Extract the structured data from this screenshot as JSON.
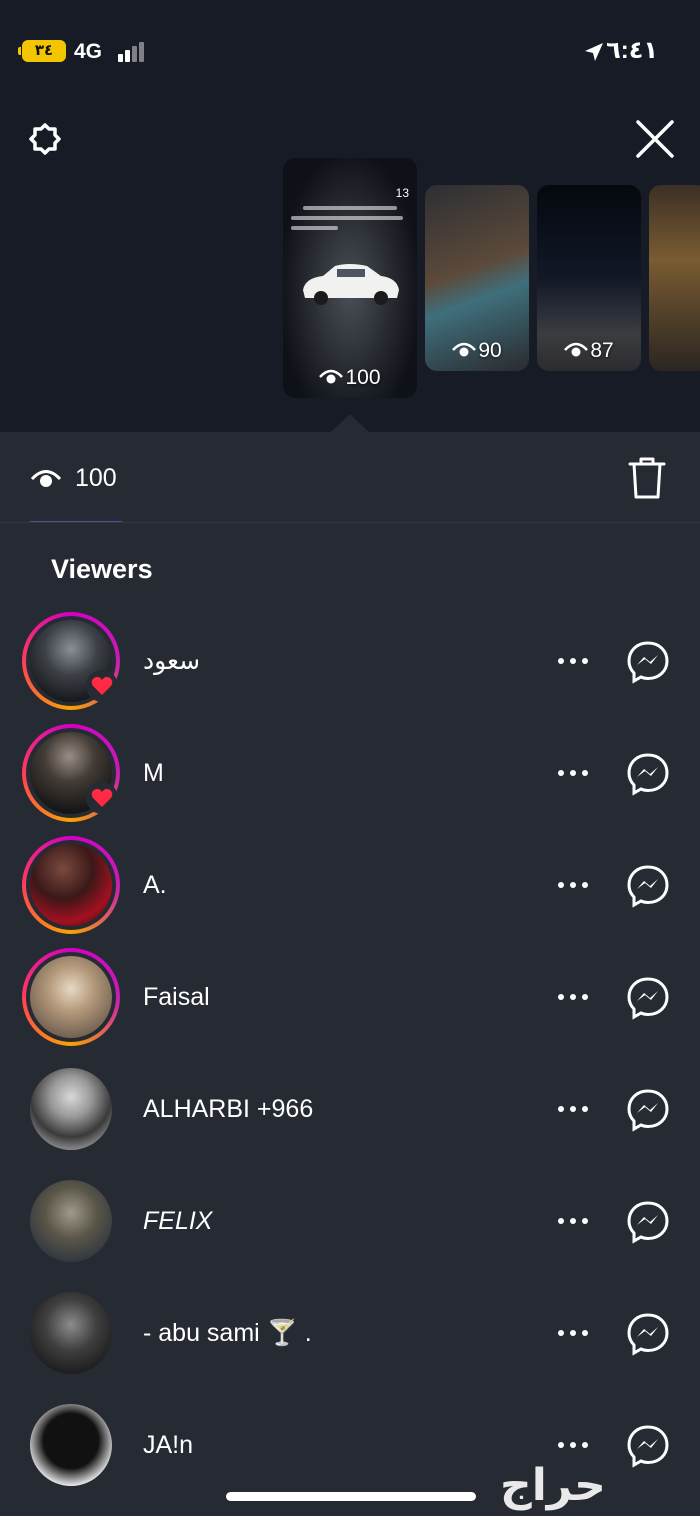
{
  "status_bar": {
    "battery": "٣٤",
    "network": "4G",
    "time": "٦:٤١",
    "battery_color": "#f2c500"
  },
  "top_bar": {
    "settings_icon": "gear-icon",
    "close_icon": "close-icon"
  },
  "stories": [
    {
      "caption": "13",
      "views": "100",
      "selected": true
    },
    {
      "views": "90"
    },
    {
      "views": "87"
    },
    {
      "views": ""
    }
  ],
  "summary": {
    "views": "100",
    "delete_icon": "trash-icon"
  },
  "viewers": {
    "title": "Viewers",
    "items": [
      {
        "name": "سعود",
        "story_ring": true,
        "liked": true,
        "italic": false
      },
      {
        "name": "M",
        "story_ring": true,
        "liked": true,
        "italic": false
      },
      {
        "name": "A.",
        "story_ring": true,
        "liked": false,
        "italic": false
      },
      {
        "name": "Faisal",
        "story_ring": true,
        "liked": false,
        "italic": false
      },
      {
        "name": "ALHARBI +966",
        "story_ring": false,
        "liked": false,
        "italic": false
      },
      {
        "name": "FELIX",
        "story_ring": false,
        "liked": false,
        "italic": true
      },
      {
        "name": "- abu sami 🍸 .",
        "story_ring": false,
        "liked": false,
        "italic": false
      },
      {
        "name": "JA!n",
        "story_ring": false,
        "liked": false,
        "italic": false
      }
    ]
  },
  "watermark": "حراج",
  "colors": {
    "background": "#262a33",
    "top_background": "#161b25",
    "like": "#ff2a44",
    "accent_underline": "#4a4f9e"
  }
}
